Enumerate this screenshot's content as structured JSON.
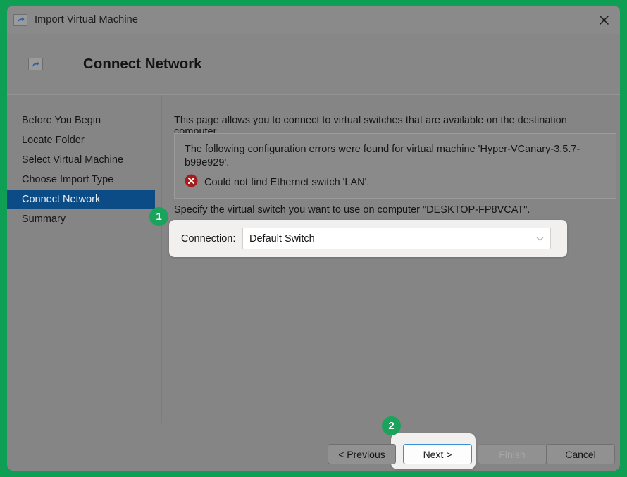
{
  "window": {
    "title": "Import Virtual Machine",
    "icon": "import-vm-icon",
    "close_label": "close-icon"
  },
  "header": {
    "title": "Connect Network",
    "icon": "import-vm-icon"
  },
  "sidebar": {
    "items": [
      {
        "label": "Before You Begin",
        "selected": false
      },
      {
        "label": "Locate Folder",
        "selected": false
      },
      {
        "label": "Select Virtual Machine",
        "selected": false
      },
      {
        "label": "Choose Import Type",
        "selected": false
      },
      {
        "label": "Connect Network",
        "selected": true
      },
      {
        "label": "Summary",
        "selected": false
      }
    ]
  },
  "main": {
    "intro_text": "This page allows you to connect to virtual switches that are available on the destination computer.",
    "error_panel": {
      "description": "The following configuration errors were found for virtual machine 'Hyper-VCanary-3.5.7-b99e929'.",
      "error_icon": "error-circle-x-icon",
      "error_message": "Could not find Ethernet switch 'LAN'."
    },
    "specify_text": "Specify the virtual switch you want to use on computer \"DESKTOP-FP8VCAT\".",
    "connection": {
      "label": "Connection:",
      "value": "Default Switch",
      "chevron": "chevron-down-icon",
      "options": [
        "Default Switch"
      ]
    }
  },
  "footer": {
    "previous_label": "< Previous",
    "next_label": "Next >",
    "finish_label": "Finish",
    "cancel_label": "Cancel"
  },
  "annotations": {
    "badge_1": "1",
    "badge_2": "2"
  },
  "colors": {
    "accent_green": "#19a35b",
    "sidebar_selected": "#0b4c86",
    "error_red": "#a71b1b",
    "focus_blue": "#3a8fd4",
    "dialog_bg": "#858585"
  }
}
